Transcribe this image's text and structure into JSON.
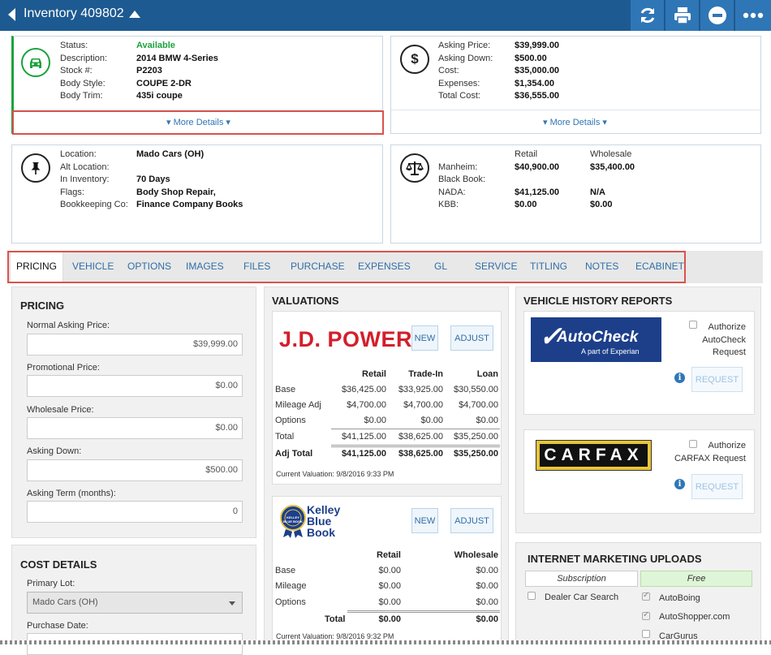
{
  "header": {
    "title": "Inventory 409802"
  },
  "summary": {
    "status_label": "Status:",
    "status_value": "Available",
    "description_label": "Description:",
    "description_value": "2014 BMW 4-Series",
    "stock_label": "Stock #:",
    "stock_value": "P2203",
    "body_style_label": "Body Style:",
    "body_style_value": "COUPE 2-DR",
    "body_trim_label": "Body Trim:",
    "body_trim_value": "435i coupe",
    "more_details": "More Details"
  },
  "pricing_summary": {
    "asking_price_label": "Asking Price:",
    "asking_price_value": "$39,999.00",
    "asking_down_label": "Asking Down:",
    "asking_down_value": "$500.00",
    "cost_label": "Cost:",
    "cost_value": "$35,000.00",
    "expenses_label": "Expenses:",
    "expenses_value": "$1,354.00",
    "total_cost_label": "Total Cost:",
    "total_cost_value": "$36,555.00",
    "more_details": "More Details"
  },
  "location": {
    "location_label": "Location:",
    "location_value": "Mado Cars (OH)",
    "alt_location_label": "Alt Location:",
    "in_inventory_label": "In Inventory:",
    "in_inventory_value": "70 Days",
    "flags_label": "Flags:",
    "flags_value": "Body Shop Repair,",
    "bookkeeping_label": "Bookkeeping Co:",
    "bookkeeping_value": "Finance Company Books"
  },
  "book_values": {
    "retail_header": "Retail",
    "wholesale_header": "Wholesale",
    "manheim_label": "Manheim:",
    "manheim_retail": "$40,900.00",
    "manheim_wholesale": "$35,400.00",
    "black_book_label": "Black Book:",
    "nada_label": "NADA:",
    "nada_retail": "$41,125.00",
    "nada_wholesale": "N/A",
    "kbb_label": "KBB:",
    "kbb_retail": "$0.00",
    "kbb_wholesale": "$0.00"
  },
  "tabs": [
    "PRICING",
    "VEHICLE",
    "OPTIONS",
    "IMAGES",
    "FILES",
    "PURCHASE",
    "EXPENSES",
    "GL",
    "SERVICE",
    "TITLING",
    "NOTES",
    "ECABINET"
  ],
  "pricing": {
    "title": "PRICING",
    "normal_label": "Normal Asking Price:",
    "normal_value": "$39,999.00",
    "promo_label": "Promotional Price:",
    "promo_value": "$0.00",
    "wholesale_label": "Wholesale Price:",
    "wholesale_value": "$0.00",
    "asking_down_label": "Asking Down:",
    "asking_down_value": "$500.00",
    "term_label": "Asking Term (months):",
    "term_value": "0"
  },
  "cost_details": {
    "title": "COST DETAILS",
    "primary_lot_label": "Primary Lot:",
    "primary_lot_value": "Mado Cars (OH)",
    "purchase_date_label": "Purchase Date:"
  },
  "valuations": {
    "title": "VALUATIONS",
    "jd": {
      "logo": "J.D. POWER",
      "new": "NEW",
      "adjust": "ADJUST",
      "headers": [
        "Retail",
        "Trade-In",
        "Loan"
      ],
      "rows": [
        {
          "label": "Base",
          "values": [
            "$36,425.00",
            "$33,925.00",
            "$30,550.00"
          ]
        },
        {
          "label": "Mileage Adj",
          "values": [
            "$4,700.00",
            "$4,700.00",
            "$4,700.00"
          ]
        },
        {
          "label": "Options",
          "values": [
            "$0.00",
            "$0.00",
            "$0.00"
          ]
        },
        {
          "label": "Total",
          "values": [
            "$41,125.00",
            "$38,625.00",
            "$35,250.00"
          ]
        }
      ],
      "adj_label": "Adj Total",
      "adj_values": [
        "$41,125.00",
        "$38,625.00",
        "$35,250.00"
      ],
      "current": "Current Valuation: 9/8/2016 9:33 PM"
    },
    "kbb": {
      "logo_line1": "Kelley",
      "logo_line2": "Blue",
      "logo_line3": "Book",
      "logo_badge": "KELLEY BLUE BOOK",
      "new": "NEW",
      "adjust": "ADJUST",
      "headers": [
        "Retail",
        "Wholesale"
      ],
      "rows": [
        {
          "label": "Base",
          "values": [
            "$0.00",
            "$0.00"
          ]
        },
        {
          "label": "Mileage",
          "values": [
            "$0.00",
            "$0.00"
          ]
        },
        {
          "label": "Options",
          "values": [
            "$0.00",
            "$0.00"
          ]
        }
      ],
      "total_label": "Total",
      "total_values": [
        "$0.00",
        "$0.00"
      ],
      "current": "Current Valuation: 9/8/2016 9:32 PM"
    }
  },
  "history": {
    "title": "VEHICLE HISTORY REPORTS",
    "autocheck": {
      "logo": "AutoCheck",
      "sub": "A part of Experian",
      "authorize": [
        "Authorize",
        "AutoCheck",
        "Request"
      ],
      "request": "REQUEST"
    },
    "carfax": {
      "logo": "CARFAX",
      "authorize": [
        "Authorize",
        "CARFAX Request"
      ],
      "request": "REQUEST"
    }
  },
  "marketing": {
    "title": "INTERNET MARKETING UPLOADS",
    "subscription": "Subscription",
    "free": "Free",
    "sub_items": [
      "Dealer Car Search"
    ],
    "free_items": [
      "AutoBoing",
      "AutoShopper.com",
      "CarGurus"
    ]
  },
  "colors": {
    "header": "#1d5a91",
    "accent": "#2f76b6",
    "available": "#1aa33b",
    "highlight": "#d9534f",
    "free": "#dff5d8"
  }
}
